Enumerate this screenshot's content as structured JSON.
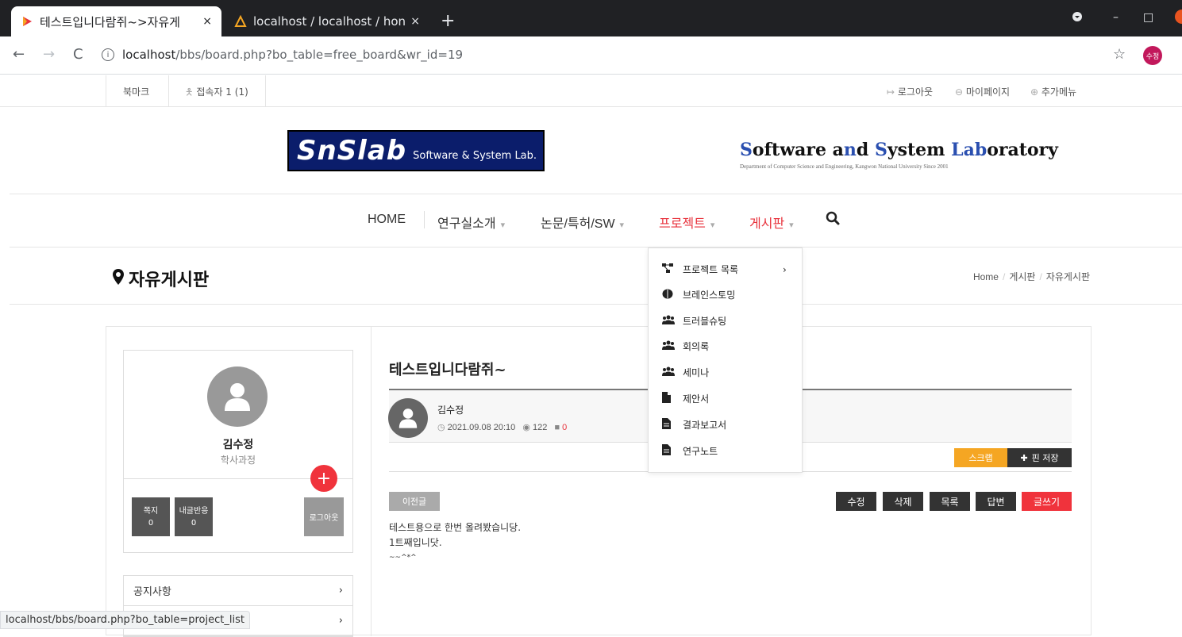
{
  "browser": {
    "tabs": [
      {
        "title": "테스트입니다람쥐~>자유게",
        "close": "×"
      },
      {
        "title": "localhost / localhost / hon",
        "close": "×"
      }
    ],
    "new_tab": "+",
    "url_host": "localhost",
    "url_path": "/bbs/board.php?bo_table=free_board&wr_id=19",
    "profile_label": "수정",
    "status_url": "localhost/bbs/board.php?bo_table=project_list"
  },
  "topbar": {
    "bookmark": "북마크",
    "visitors": "접속자 1 (1)",
    "logout": "로그아웃",
    "mypage": "마이페이지",
    "more": "추가메뉴"
  },
  "header": {
    "logo_main": "SnSlab",
    "logo_sub": "Software & System Lab.",
    "lab_title_parts": [
      "S",
      "oftware a",
      "n",
      "d ",
      "S",
      "ystem ",
      "Lab",
      "oratory"
    ],
    "lab_subtitle": "Department of Computer Science and Engineering, Kangwon National University      Since 2001"
  },
  "nav": {
    "items": [
      "HOME",
      "연구실소개",
      "논문/특허/SW",
      "프로젝트",
      "게시판"
    ],
    "active_color": "#e8323c"
  },
  "dropdown": {
    "items": [
      {
        "icon": "sitemap-icon",
        "label": "프로젝트 목록"
      },
      {
        "icon": "brain-icon",
        "label": "브레인스토밍"
      },
      {
        "icon": "users-icon",
        "label": "트러블슈팅"
      },
      {
        "icon": "users-icon",
        "label": "회의록"
      },
      {
        "icon": "users-icon",
        "label": "세미나"
      },
      {
        "icon": "file-icon",
        "label": "제안서"
      },
      {
        "icon": "file-text-icon",
        "label": "결과보고서"
      },
      {
        "icon": "file-text-icon",
        "label": "연구노트"
      }
    ]
  },
  "page": {
    "title": "자유게시판",
    "breadcrumb": [
      "Home",
      "게시판",
      "자유게시판"
    ]
  },
  "profile": {
    "name": "김수정",
    "role": "학사과정",
    "memo_label": "쪽지",
    "memo_count": "0",
    "reply_label": "내글반응",
    "reply_count": "0",
    "logout_label": "로그아웃"
  },
  "sidemenu": {
    "items": [
      "공지사항",
      ""
    ]
  },
  "post": {
    "title": "테스트입니다람쥐~",
    "author": "김수정",
    "datetime": "2021.09.08 20:10",
    "views": "122",
    "comments": "0",
    "scrap": "스크랩",
    "pin": "핀 저장",
    "prev": "이전글",
    "actions": [
      "수정",
      "삭제",
      "목록",
      "답변",
      "글쓰기"
    ],
    "body": [
      "테스트용으로 한번 올려봤습니당.",
      "1트째입니닷.",
      "~~^*^"
    ]
  },
  "colors": {
    "accent_red": "#f0333c",
    "scrap_orange": "#f5a623",
    "logo_navy": "#0b1d6b"
  }
}
